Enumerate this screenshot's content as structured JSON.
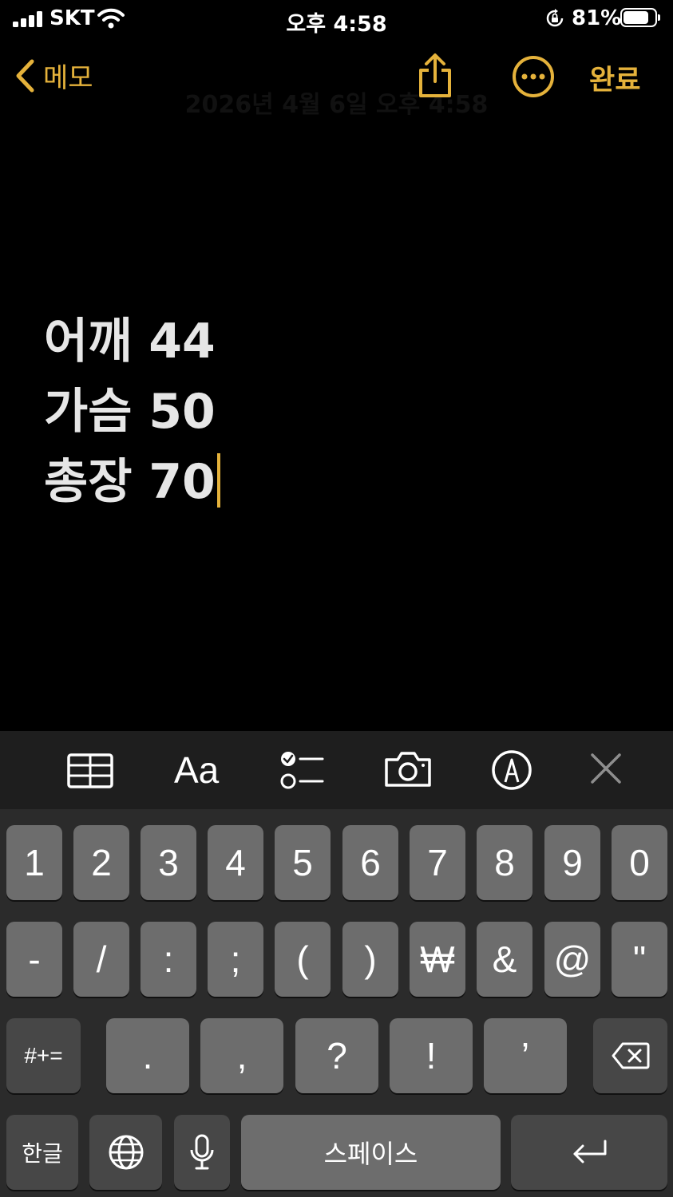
{
  "status_bar": {
    "carrier": "SKT",
    "time": "오후 4:58",
    "battery": "81%",
    "battery_level": 0.81
  },
  "nav": {
    "back_label": "메모",
    "done_label": "완료",
    "date": "2026년 4월 6일 오후 4:58"
  },
  "note": {
    "lines": [
      "어깨 44",
      "가슴 50",
      "총장 70"
    ]
  },
  "toolbar": {
    "format_label": "Aa",
    "icons": [
      "table-icon",
      "format-icon",
      "checklist-icon",
      "camera-icon",
      "markup-icon",
      "close-icon"
    ]
  },
  "keyboard": {
    "row1": [
      "1",
      "2",
      "3",
      "4",
      "5",
      "6",
      "7",
      "8",
      "9",
      "0"
    ],
    "row2": [
      "-",
      "/",
      ":",
      ";",
      "(",
      ")",
      "₩",
      "&",
      "@",
      "\""
    ],
    "row3": {
      "symbols_label": "#+=",
      "keys": [
        ".",
        ",",
        "?",
        "!",
        "’"
      ]
    },
    "row4": {
      "language_label": "한글",
      "space_label": "스페이스"
    }
  },
  "colors": {
    "accent": "#e5b23b",
    "key": "#6d6d6d",
    "key_dark": "#474747"
  }
}
